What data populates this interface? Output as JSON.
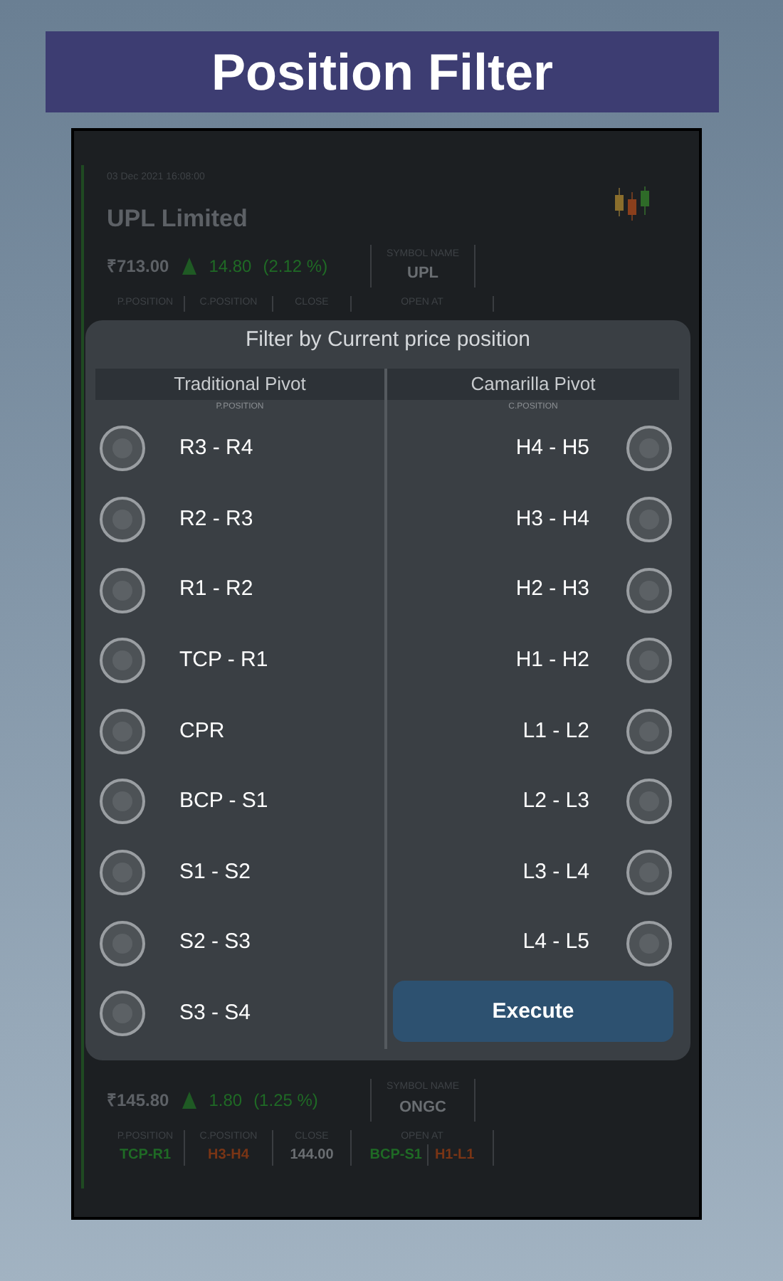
{
  "banner": {
    "title": "Position Filter"
  },
  "background_cards": [
    {
      "date": "03 Dec 2021 16:08:00",
      "name": "UPL Limited",
      "price": "₹713.00",
      "change": "14.80",
      "change_pct": "(2.12 %)",
      "symbol_label": "SYMBOL NAME",
      "symbol": "UPL",
      "column_labels": [
        "P.POSITION",
        "C.POSITION",
        "CLOSE",
        "OPEN AT"
      ]
    },
    {
      "price": "₹145.80",
      "change": "1.80",
      "change_pct": "(1.25 %)",
      "symbol_label": "SYMBOL NAME",
      "symbol": "ONGC",
      "column_labels": [
        "P.POSITION",
        "C.POSITION",
        "CLOSE",
        "OPEN AT"
      ],
      "p_position": "TCP-R1",
      "c_position": "H3-H4",
      "close": "144.00",
      "open_at": [
        "BCP-S1",
        "H1-L1"
      ]
    }
  ],
  "dialog": {
    "title": "Filter by Current price position",
    "columns": [
      {
        "header": "Traditional Pivot",
        "sublabel": "P.POSITION",
        "options": [
          {
            "label": "R3 - R4",
            "selected": false
          },
          {
            "label": "R2 - R3",
            "selected": false
          },
          {
            "label": "R1 - R2",
            "selected": false
          },
          {
            "label": "TCP - R1",
            "selected": false
          },
          {
            "label": "CPR",
            "selected": false
          },
          {
            "label": "BCP - S1",
            "selected": false
          },
          {
            "label": "S1 - S2",
            "selected": false
          },
          {
            "label": "S2 - S3",
            "selected": false
          },
          {
            "label": "S3 - S4",
            "selected": false
          }
        ]
      },
      {
        "header": "Camarilla Pivot",
        "sublabel": "C.POSITION",
        "options": [
          {
            "label": "H4 - H5",
            "selected": false
          },
          {
            "label": "H3 - H4",
            "selected": false
          },
          {
            "label": "H2 - H3",
            "selected": false
          },
          {
            "label": "H1 - H2",
            "selected": false
          },
          {
            "label": "L1 - L2",
            "selected": false
          },
          {
            "label": "L2 - L3",
            "selected": false
          },
          {
            "label": "L3 - L4",
            "selected": false
          },
          {
            "label": "L4 - L5",
            "selected": false
          }
        ]
      }
    ],
    "button": "Execute"
  }
}
